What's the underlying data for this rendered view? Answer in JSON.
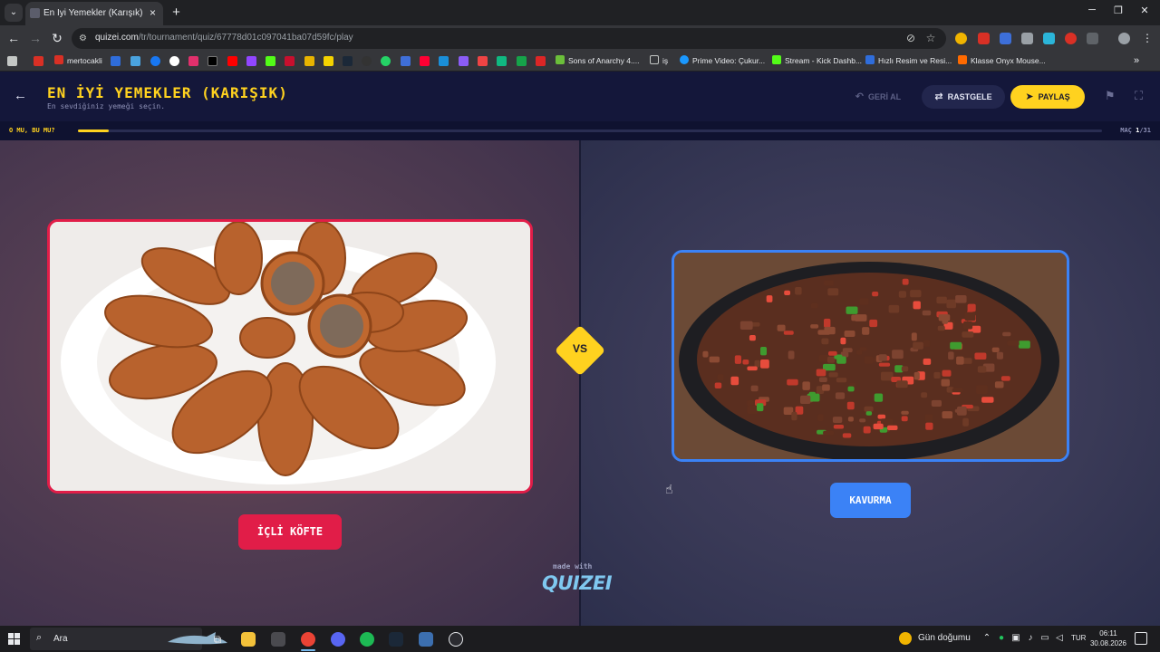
{
  "browser": {
    "tab_title": "En İyi Yemekler (Karışık) - Tier L",
    "tab_close": "×",
    "new_tab": "+",
    "url_host": "quizei.com",
    "url_path": "/tr/tournament/quiz/67778d01c097041ba07d59fc/play",
    "bookmarks": [
      "mertocakli",
      "Sons of Anarchy 4....",
      "iş",
      "Prime Video: Çukur...",
      "Stream - Kick Dashb...",
      "Hızlı Resim ve Resi...",
      "Klasse Onyx Mouse..."
    ]
  },
  "app": {
    "title": "EN İYİ YEMEKLER (KARIŞIK)",
    "subtitle": "En sevdiğiniz yemeği seçin.",
    "undo_label": "GERİ AL",
    "random_label": "RASTGELE",
    "share_label": "PAYLAŞ",
    "progress_label": "O MU, BU MU?",
    "match_prefix": "MAÇ",
    "match_current": "1",
    "match_total": "/31",
    "match_progress": 0.03,
    "vs_label": "VS",
    "left_choice": "İÇLİ KÖFTE",
    "right_choice": "KAVURMA",
    "made_with": "made with",
    "brand": "QUIZEI",
    "colors": {
      "accent": "#ffd21f",
      "left": "#e11d48",
      "right": "#3b82f6"
    }
  },
  "taskbar": {
    "search_placeholder": "Ara",
    "weather": "Gün doğumu",
    "language": "TUR",
    "time": "06:11",
    "date": "30.08.2026"
  }
}
